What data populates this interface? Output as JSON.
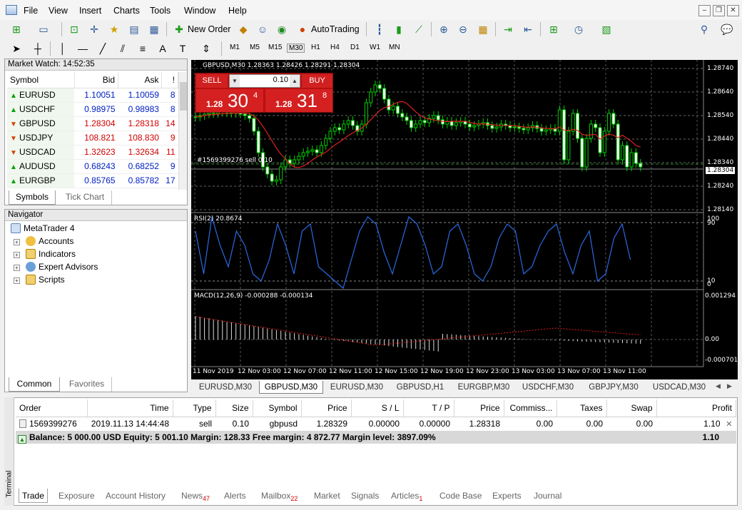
{
  "menu": [
    "File",
    "View",
    "Insert",
    "Charts",
    "Tools",
    "Window",
    "Help"
  ],
  "toolbar": {
    "new_order": "New Order",
    "autotrading": "AutoTrading"
  },
  "timeframes": [
    "M1",
    "M5",
    "M15",
    "M30",
    "H1",
    "H4",
    "D1",
    "W1",
    "MN"
  ],
  "market_watch": {
    "title": "Market Watch: 14:52:35",
    "headers": [
      "Symbol",
      "Bid",
      "Ask",
      "!"
    ],
    "rows": [
      {
        "symbol": "EURUSD",
        "bid": "1.10051",
        "ask": "1.10059",
        "spread": "8",
        "dir": "up"
      },
      {
        "symbol": "USDCHF",
        "bid": "0.98975",
        "ask": "0.98983",
        "spread": "8",
        "dir": "up"
      },
      {
        "symbol": "GBPUSD",
        "bid": "1.28304",
        "ask": "1.28318",
        "spread": "14",
        "dir": "down"
      },
      {
        "symbol": "USDJPY",
        "bid": "108.821",
        "ask": "108.830",
        "spread": "9",
        "dir": "down"
      },
      {
        "symbol": "USDCAD",
        "bid": "1.32623",
        "ask": "1.32634",
        "spread": "11",
        "dir": "down"
      },
      {
        "symbol": "AUDUSD",
        "bid": "0.68243",
        "ask": "0.68252",
        "spread": "9",
        "dir": "up"
      },
      {
        "symbol": "EURGBP",
        "bid": "0.85765",
        "ask": "0.85782",
        "spread": "17",
        "dir": "up"
      }
    ],
    "tabs": [
      "Symbols",
      "Tick Chart"
    ]
  },
  "navigator": {
    "title": "Navigator",
    "root": "MetaTrader 4",
    "items": [
      "Accounts",
      "Indicators",
      "Expert Advisors",
      "Scripts"
    ],
    "tabs": [
      "Common",
      "Favorites"
    ]
  },
  "chart": {
    "title": "GBPUSD,M30  1.28363 1.28426 1.28291 1.28304",
    "sell_label": "SELL",
    "buy_label": "BUY",
    "lot": "0.10",
    "sell_big": "1.28",
    "sell_pips": "30",
    "sell_sup": "4",
    "buy_big": "1.28",
    "buy_pips": "31",
    "buy_sup": "8",
    "order_line": "#1569399276 sell 0.10",
    "price_axis": [
      "1.28740",
      "1.28640",
      "1.28540",
      "1.28440",
      "1.28340",
      "1.28304",
      "1.28240",
      "1.28140"
    ],
    "rsi_label": "RSI(2) 20.8674",
    "rsi_axis": [
      "100",
      "90",
      "10",
      "0"
    ],
    "macd_label": "MACD(12,26,9) -0.000288 -0.000134",
    "macd_axis": [
      "0.001294",
      "0.00",
      "-0.000701"
    ],
    "time_axis": [
      "11 Nov 2019",
      "12 Nov 03:00",
      "12 Nov 07:00",
      "12 Nov 11:00",
      "12 Nov 15:00",
      "12 Nov 19:00",
      "12 Nov 23:00",
      "13 Nov 03:00",
      "13 Nov 07:00",
      "13 Nov 11:00"
    ]
  },
  "chart_tabs": [
    "EURUSD,M30",
    "GBPUSD,M30",
    "EURUSD,M30",
    "GBPUSD,H1",
    "EURGBP,M30",
    "USDCHF,M30",
    "GBPJPY,M30",
    "USDCAD,M30"
  ],
  "terminal": {
    "label": "Terminal",
    "headers": [
      "Order",
      "Time",
      "Type",
      "Size",
      "Symbol",
      "Price",
      "S / L",
      "T / P",
      "Price",
      "Commiss...",
      "Taxes",
      "Swap",
      "Profit"
    ],
    "order": {
      "order": "1569399276",
      "time": "2019.11.13 14:44:48",
      "type": "sell",
      "size": "0.10",
      "symbol": "gbpusd",
      "price": "1.28329",
      "sl": "0.00000",
      "tp": "0.00000",
      "cur_price": "1.28318",
      "commission": "0.00",
      "taxes": "0.00",
      "swap": "0.00",
      "profit": "1.10"
    },
    "balance": "Balance: 5 000.00 USD  Equity: 5 001.10  Margin: 128.33  Free margin: 4 872.77  Margin level: 3897.09%",
    "balance_profit": "1.10",
    "tabs": [
      {
        "label": "Trade",
        "badge": ""
      },
      {
        "label": "Exposure",
        "badge": ""
      },
      {
        "label": "Account History",
        "badge": ""
      },
      {
        "label": "News",
        "badge": "47"
      },
      {
        "label": "Alerts",
        "badge": ""
      },
      {
        "label": "Mailbox",
        "badge": "22"
      },
      {
        "label": "Market",
        "badge": ""
      },
      {
        "label": "Signals",
        "badge": ""
      },
      {
        "label": "Articles",
        "badge": "1"
      },
      {
        "label": "Code Base",
        "badge": ""
      },
      {
        "label": "Experts",
        "badge": ""
      },
      {
        "label": "Journal",
        "badge": ""
      }
    ]
  }
}
